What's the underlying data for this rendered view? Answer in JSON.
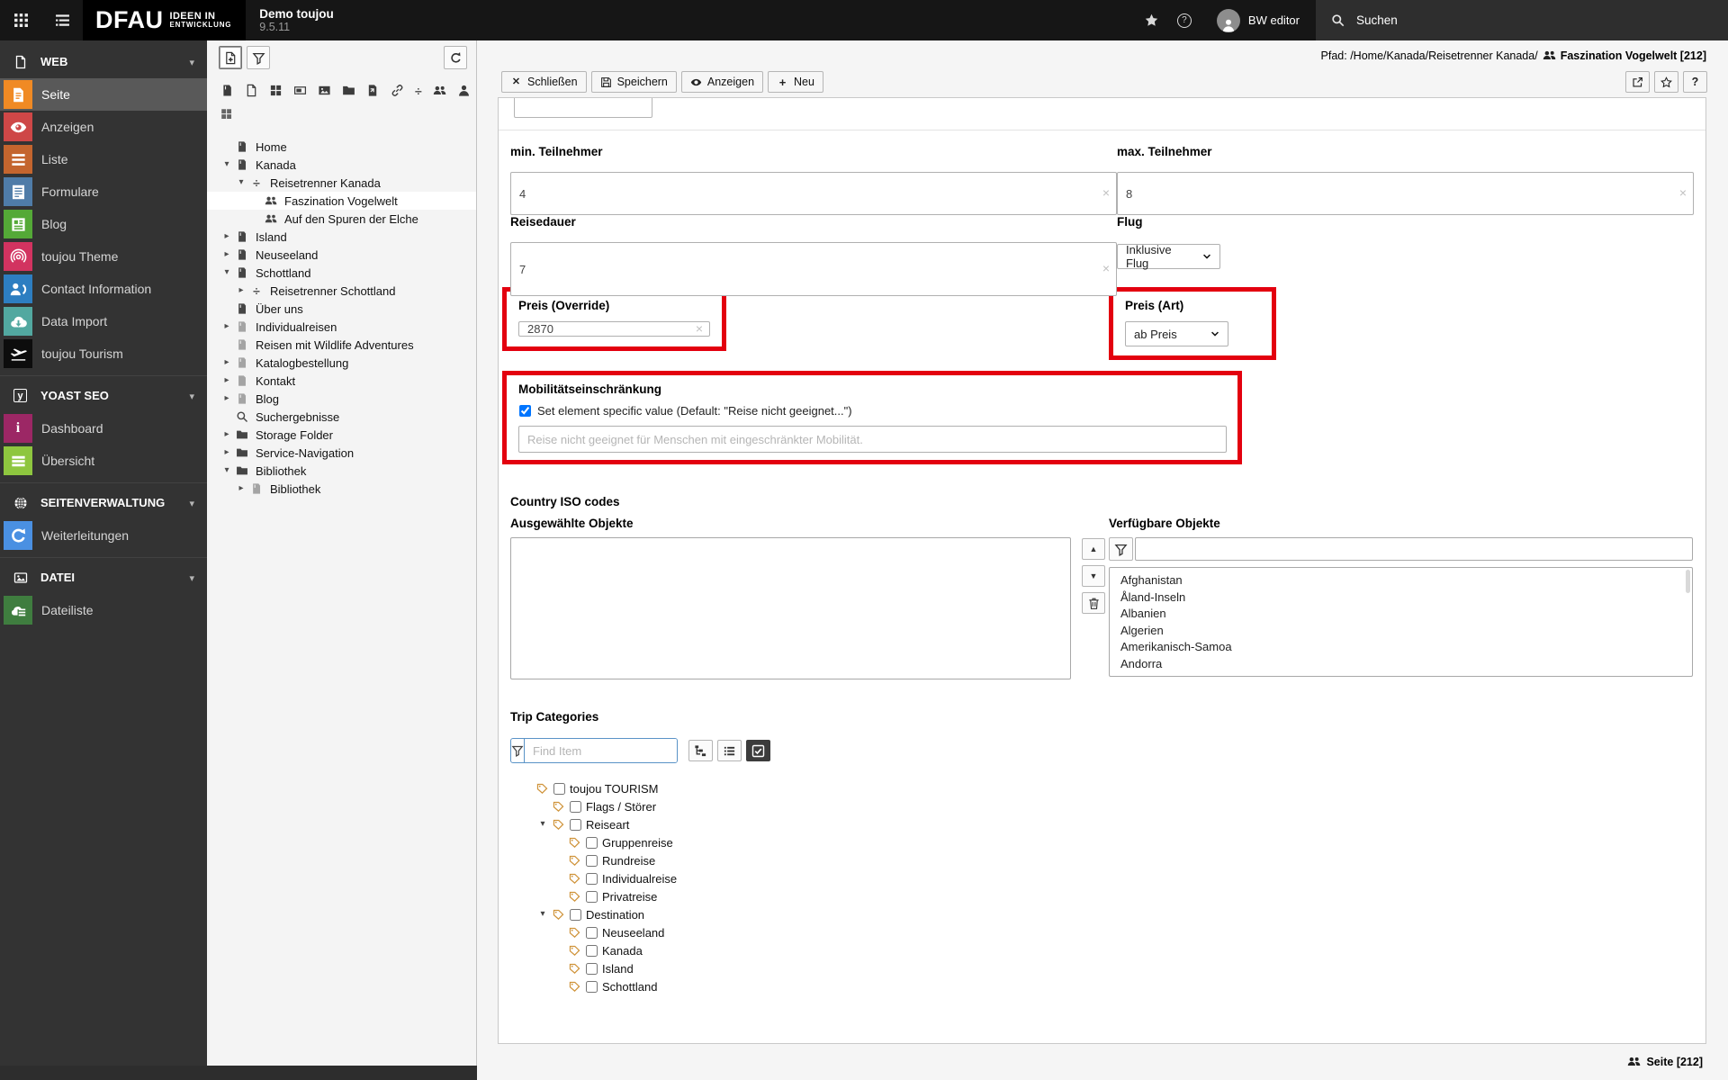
{
  "colors": {
    "highlight_red": "#e3000f",
    "filter_blue": "#5a93c7",
    "active_module_orange": "#f08a24"
  },
  "topbar": {
    "logo_main": "DFAU",
    "logo_sub1": "IDEEN IN",
    "logo_sub2": "ENTWICKLUNG",
    "site_name": "Demo toujou",
    "version": "9.5.11",
    "username": "BW editor",
    "search_label": "Suchen"
  },
  "module_menu": {
    "sections": [
      {
        "label": "WEB",
        "icon": "webdoc",
        "items": [
          {
            "label": "Seite",
            "icon": "doc",
            "color": "#f08a24",
            "active": true
          },
          {
            "label": "Anzeigen",
            "icon": "eye",
            "color": "#ce4747",
            "active": false
          },
          {
            "label": "Liste",
            "icon": "rows",
            "color": "#c4652e",
            "active": false
          },
          {
            "label": "Formulare",
            "icon": "form",
            "color": "#4f7ca8",
            "active": false
          },
          {
            "label": "Blog",
            "icon": "news",
            "color": "#54a937",
            "active": false
          },
          {
            "label": "toujou Theme",
            "icon": "finger",
            "color": "#d23360",
            "active": false
          },
          {
            "label": "Contact Information",
            "icon": "contact",
            "color": "#2d7ec1",
            "active": false
          },
          {
            "label": "Data Import",
            "icon": "clouddown",
            "color": "#52a8a0",
            "active": false
          },
          {
            "label": "toujou Tourism",
            "icon": "plane",
            "color": "#0d0d0d",
            "active": false
          }
        ]
      },
      {
        "label": "YOAST SEO",
        "icon": "yoast",
        "items": [
          {
            "label": "Dashboard",
            "icon": "info",
            "color": "#9c2765",
            "active": false
          },
          {
            "label": "Übersicht",
            "icon": "bars3",
            "color": "#8ec63f",
            "active": false
          }
        ]
      },
      {
        "label": "SEITENVERWALTUNG",
        "icon": "globe",
        "items": [
          {
            "label": "Weiterleitungen",
            "icon": "crefresh",
            "color": "#4a90e2",
            "active": false
          }
        ]
      },
      {
        "label": "DATEI",
        "icon": "imageframe",
        "items": [
          {
            "label": "Dateiliste",
            "icon": "cloudlist",
            "color": "#3f7d3f",
            "active": false
          }
        ]
      }
    ]
  },
  "page_tree": {
    "toolbar_icons": [
      "page-dark",
      "page-outline",
      "content-grid",
      "banner",
      "image",
      "folder",
      "page-shortcut",
      "link",
      "divider",
      "user-group",
      "user"
    ],
    "items": [
      {
        "label": "Home",
        "depth": 0,
        "exp": "none",
        "icon": "page",
        "dim": false,
        "selected": false
      },
      {
        "label": "Kanada",
        "depth": 0,
        "exp": "open",
        "icon": "page",
        "dim": false,
        "selected": false
      },
      {
        "label": "Reisetrenner Kanada",
        "depth": 1,
        "exp": "open",
        "icon": "divider",
        "dim": false,
        "selected": false
      },
      {
        "label": "Faszination Vogelwelt",
        "depth": 2,
        "exp": "none",
        "icon": "group",
        "dim": false,
        "selected": true
      },
      {
        "label": "Auf den Spuren der Elche",
        "depth": 2,
        "exp": "none",
        "icon": "group",
        "dim": false,
        "selected": false
      },
      {
        "label": "Island",
        "depth": 0,
        "exp": "closed",
        "icon": "page",
        "dim": false,
        "selected": false
      },
      {
        "label": "Neuseeland",
        "depth": 0,
        "exp": "closed",
        "icon": "page",
        "dim": false,
        "selected": false
      },
      {
        "label": "Schottland",
        "depth": 0,
        "exp": "open",
        "icon": "page",
        "dim": false,
        "selected": false
      },
      {
        "label": "Reisetrenner Schottland",
        "depth": 1,
        "exp": "closed",
        "icon": "divider",
        "dim": false,
        "selected": false
      },
      {
        "label": "Über uns",
        "depth": 0,
        "exp": "none",
        "icon": "page",
        "dim": false,
        "selected": false
      },
      {
        "label": "Individualreisen",
        "depth": 0,
        "exp": "closed",
        "icon": "page",
        "dim": true,
        "selected": false
      },
      {
        "label": "Reisen mit Wildlife Adventures",
        "depth": 0,
        "exp": "none",
        "icon": "page",
        "dim": true,
        "selected": false
      },
      {
        "label": "Katalogbestellung",
        "depth": 0,
        "exp": "closed",
        "icon": "page",
        "dim": true,
        "selected": false
      },
      {
        "label": "Kontakt",
        "depth": 0,
        "exp": "closed",
        "icon": "docfile",
        "dim": true,
        "selected": false
      },
      {
        "label": "Blog",
        "depth": 0,
        "exp": "closed",
        "icon": "page",
        "dim": true,
        "selected": false
      },
      {
        "label": "Suchergebnisse",
        "depth": 0,
        "exp": "none",
        "icon": "search",
        "dim": false,
        "selected": false
      },
      {
        "label": "Storage Folder",
        "depth": 0,
        "exp": "closed",
        "icon": "folder",
        "dim": false,
        "selected": false
      },
      {
        "label": "Service-Navigation",
        "depth": 0,
        "exp": "closed",
        "icon": "folder",
        "dim": false,
        "selected": false
      },
      {
        "label": "Bibliothek",
        "depth": 0,
        "exp": "open",
        "icon": "folder",
        "dim": false,
        "selected": false
      },
      {
        "label": "Bibliothek",
        "depth": 1,
        "exp": "closed",
        "icon": "page",
        "dim": true,
        "selected": false
      }
    ]
  },
  "docheader": {
    "path_prefix": "Pfad: /Home/Kanada/Reisetrenner Kanada/",
    "current_page": "Faszination Vogelwelt [212]",
    "close_label": "Schließen",
    "save_label": "Speichern",
    "view_label": "Anzeigen",
    "new_label": "Neu"
  },
  "form": {
    "min_participants": {
      "label": "min. Teilnehmer",
      "value": "4"
    },
    "max_participants": {
      "label": "max. Teilnehmer",
      "value": "8"
    },
    "duration": {
      "label": "Reisedauer",
      "value": "7"
    },
    "flight": {
      "label": "Flug",
      "value": "Inklusive Flug"
    },
    "price_override": {
      "label": "Preis (Override)",
      "value": "2870"
    },
    "price_type": {
      "label": "Preis (Art)",
      "value": "ab Preis"
    },
    "mobility": {
      "label": "Mobilitätseinschränkung",
      "checkbox_label": "Set element specific value (Default: \"Reise nicht geeignet...\")",
      "placeholder": "Reise nicht geeignet für Menschen mit eingeschränkter Mobilität."
    },
    "country_iso": {
      "label": "Country ISO codes",
      "selected_label": "Ausgewählte Objekte",
      "available_label": "Verfügbare Objekte",
      "available_items": [
        "Afghanistan",
        "Åland-Inseln",
        "Albanien",
        "Algerien",
        "Amerikanisch-Samoa",
        "Andorra"
      ]
    },
    "trip_categories": {
      "label": "Trip Categories",
      "filter_placeholder": "Find Item",
      "tree": [
        {
          "label": "toujou TOURISM",
          "depth": 0,
          "exp": "none"
        },
        {
          "label": "Flags / Störer",
          "depth": 1,
          "exp": "none"
        },
        {
          "label": "Reiseart",
          "depth": 1,
          "exp": "open"
        },
        {
          "label": "Gruppenreise",
          "depth": 2,
          "exp": "none"
        },
        {
          "label": "Rundreise",
          "depth": 2,
          "exp": "none"
        },
        {
          "label": "Individualreise",
          "depth": 2,
          "exp": "none"
        },
        {
          "label": "Privatreise",
          "depth": 2,
          "exp": "none"
        },
        {
          "label": "Destination",
          "depth": 1,
          "exp": "open"
        },
        {
          "label": "Neuseeland",
          "depth": 2,
          "exp": "none"
        },
        {
          "label": "Kanada",
          "depth": 2,
          "exp": "none"
        },
        {
          "label": "Island",
          "depth": 2,
          "exp": "none"
        },
        {
          "label": "Schottland",
          "depth": 2,
          "exp": "none"
        }
      ]
    }
  },
  "footer": {
    "page_label": "Seite [212]"
  }
}
